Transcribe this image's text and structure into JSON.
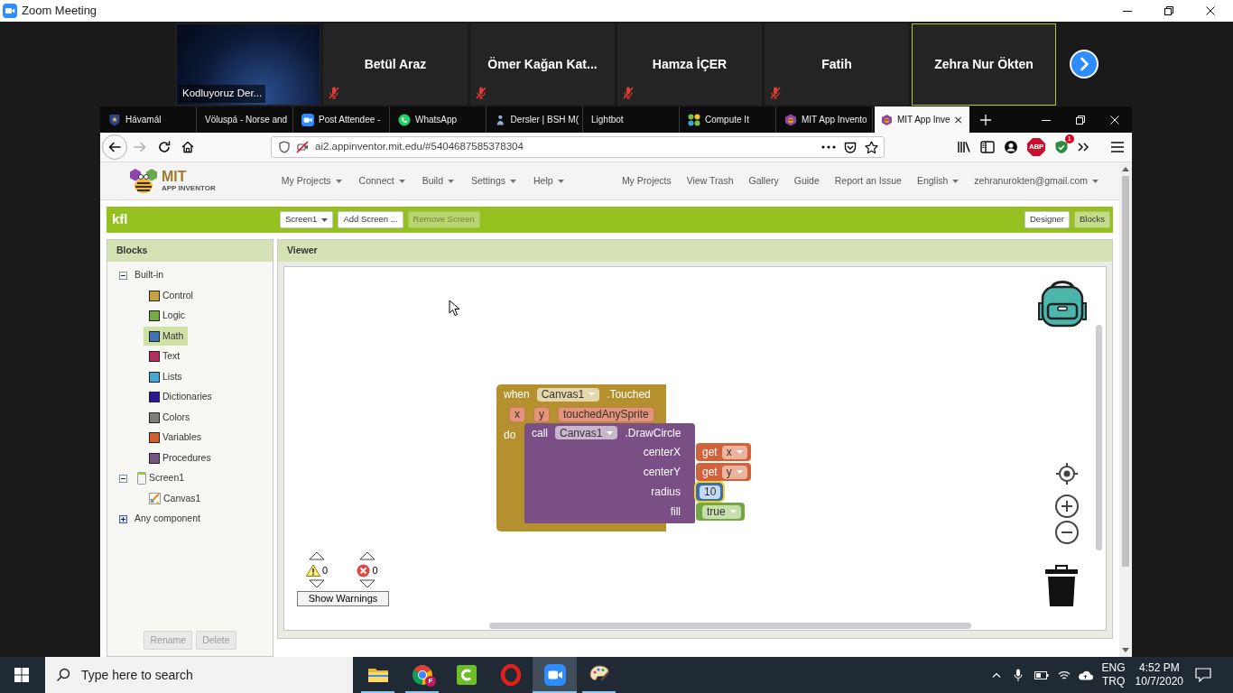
{
  "zoom_window": {
    "title": "Zoom Meeting"
  },
  "participants": [
    {
      "name": "Kodluyoruz Der...",
      "kind": "video",
      "muted": false,
      "speaking": false
    },
    {
      "name": "Betül Araz",
      "kind": "name",
      "muted": true,
      "speaking": false
    },
    {
      "name": "Ömer Kağan Kat...",
      "kind": "name",
      "muted": true,
      "speaking": false
    },
    {
      "name": "Hamza İÇER",
      "kind": "name",
      "muted": true,
      "speaking": false
    },
    {
      "name": "Fatih",
      "kind": "name",
      "muted": true,
      "speaking": false
    },
    {
      "name": "Zehra Nur Ökten",
      "kind": "name",
      "muted": false,
      "speaking": true
    }
  ],
  "browser": {
    "tabs": [
      {
        "title": "Hávamál",
        "selected": false
      },
      {
        "title": "Völuspá - Norse and",
        "selected": false
      },
      {
        "title": "Post Attendee -",
        "selected": false
      },
      {
        "title": "WhatsApp",
        "selected": false
      },
      {
        "title": "Dersler | BSH M(",
        "selected": false
      },
      {
        "title": "Lightbot",
        "selected": false
      },
      {
        "title": "Compute It",
        "selected": false
      },
      {
        "title": "MIT App Invento",
        "selected": false
      },
      {
        "title": "MIT App Inve",
        "selected": true
      }
    ],
    "url": "ai2.appinventor.mit.edu/#5404687585378304",
    "adblock_label": "ABP",
    "extension_badge": "1"
  },
  "app": {
    "logo_title": "MIT",
    "logo_subtitle": "APP INVENTOR",
    "menus": [
      {
        "label": "My Projects",
        "dropdown": true
      },
      {
        "label": "Connect",
        "dropdown": true
      },
      {
        "label": "Build",
        "dropdown": true
      },
      {
        "label": "Settings",
        "dropdown": true
      },
      {
        "label": "Help",
        "dropdown": true
      }
    ],
    "links": [
      {
        "label": "My Projects",
        "dropdown": false
      },
      {
        "label": "View Trash",
        "dropdown": false
      },
      {
        "label": "Gallery",
        "dropdown": false
      },
      {
        "label": "Guide",
        "dropdown": false
      },
      {
        "label": "Report an Issue",
        "dropdown": false
      },
      {
        "label": "English",
        "dropdown": true
      },
      {
        "label": "zehranurokten@gmail.com",
        "dropdown": true
      }
    ]
  },
  "project": {
    "name": "kfl",
    "screen": "Screen1",
    "actions": [
      {
        "label": "Add Screen ...",
        "disabled": false
      },
      {
        "label": "Remove Screen",
        "disabled": true
      }
    ],
    "views": [
      {
        "label": "Designer",
        "selected": false
      },
      {
        "label": "Blocks",
        "selected": true
      }
    ]
  },
  "blocks_panel": {
    "title": "Blocks",
    "tree": [
      {
        "label": "Built-in",
        "kind": "group",
        "expanded": true,
        "selected": false,
        "children": [
          {
            "label": "Control",
            "kind": "drawer",
            "color": "#c6a23c",
            "selected": false
          },
          {
            "label": "Logic",
            "kind": "drawer",
            "color": "#77ab41",
            "selected": false
          },
          {
            "label": "Math",
            "kind": "drawer",
            "color": "#3f71b5",
            "selected": true
          },
          {
            "label": "Text",
            "kind": "drawer",
            "color": "#b32d5e",
            "selected": false
          },
          {
            "label": "Lists",
            "kind": "drawer",
            "color": "#49a6d4",
            "selected": false
          },
          {
            "label": "Dictionaries",
            "kind": "drawer",
            "color": "#2d1799",
            "selected": false
          },
          {
            "label": "Colors",
            "kind": "drawer",
            "color": "#7d7d7d",
            "selected": false
          },
          {
            "label": "Variables",
            "kind": "drawer",
            "color": "#d05f2d",
            "selected": false
          },
          {
            "label": "Procedures",
            "kind": "drawer",
            "color": "#7c5385",
            "selected": false
          }
        ]
      },
      {
        "label": "Screen1",
        "kind": "screen",
        "expanded": true,
        "selected": false,
        "children": [
          {
            "label": "Canvas1",
            "kind": "canvas",
            "selected": false
          }
        ]
      },
      {
        "label": "Any component",
        "kind": "group",
        "expanded": false,
        "selected": false
      }
    ],
    "actions": [
      {
        "label": "Rename",
        "disabled": true
      },
      {
        "label": "Delete",
        "disabled": true
      }
    ]
  },
  "viewer": {
    "title": "Viewer",
    "event_block": {
      "keyword": "when",
      "component": "Canvas1",
      "event": ".Touched",
      "params": [
        "x",
        "y",
        "touchedAnySprite"
      ],
      "do_label": "do"
    },
    "call_block": {
      "keyword": "call",
      "component": "Canvas1",
      "method": ".DrawCircle",
      "args": [
        {
          "name": "centerX",
          "kind": "get",
          "keyword": "get",
          "value": "x",
          "selected": false
        },
        {
          "name": "centerY",
          "kind": "get",
          "keyword": "get",
          "value": "y",
          "selected": false
        },
        {
          "name": "radius",
          "kind": "number",
          "value": "10",
          "selected": true
        },
        {
          "name": "fill",
          "kind": "boolean",
          "value": "true",
          "selected": false
        }
      ]
    },
    "warnings": {
      "warning_count": "0",
      "error_count": "0",
      "button": "Show Warnings"
    }
  },
  "taskbar": {
    "search_placeholder": "Type here to search",
    "apps": [
      {
        "running": true,
        "active": false
      },
      {
        "running": true,
        "active": false,
        "badge": "F"
      },
      {
        "running": false,
        "active": false
      },
      {
        "running": false,
        "active": false
      },
      {
        "running": true,
        "active": true
      },
      {
        "running": true,
        "active": false
      }
    ],
    "input_language": "ENG",
    "keyboard": "TRQ",
    "time": "4:52 PM",
    "date": "10/7/2020"
  }
}
